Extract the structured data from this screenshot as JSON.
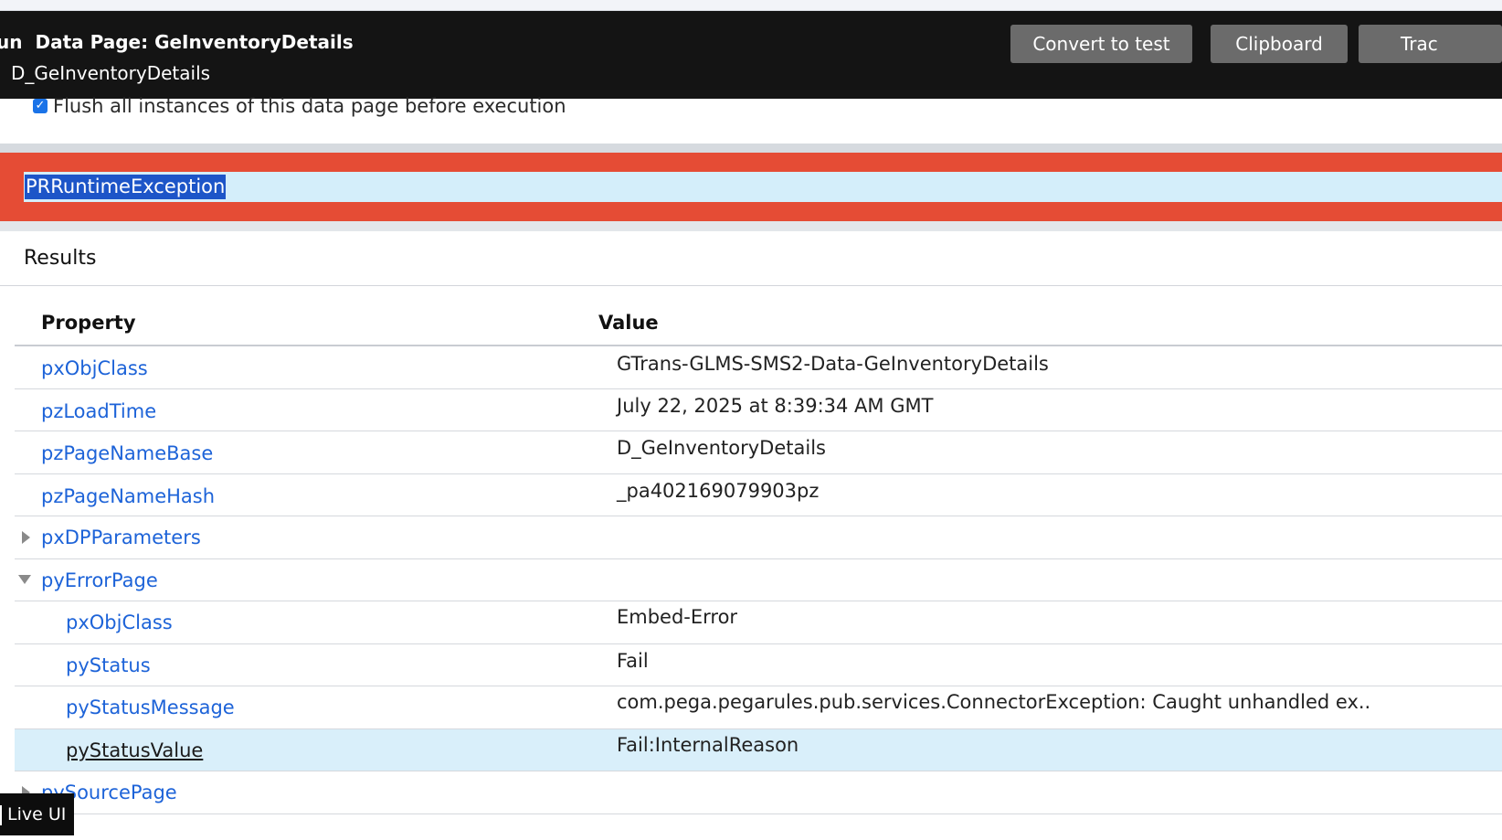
{
  "header": {
    "title_prefix": "un",
    "title_label": "Data Page:",
    "title_name": "GeInventoryDetails",
    "subtitle": "D_GeInventoryDetails",
    "buttons": [
      "Convert to test",
      "Clipboard",
      "Trac"
    ]
  },
  "flush_checkbox": {
    "checked": true,
    "label": "Flush all instances of this data page before execution"
  },
  "error": {
    "text": "PRRuntimeException"
  },
  "results": {
    "title": "Results",
    "columns": [
      "Property",
      "Value"
    ],
    "rows": [
      {
        "property": "pxObjClass",
        "value": "GTrans-GLMS-SMS2-Data-GeInventoryDetails"
      },
      {
        "property": "pzLoadTime",
        "value": "July 22, 2025 at 8:39:34 AM GMT"
      },
      {
        "property": "pzPageNameBase",
        "value": "D_GeInventoryDetails"
      },
      {
        "property": "pzPageNameHash",
        "value": "_pa402169079903pz"
      },
      {
        "property": "pxDPParameters",
        "value": "",
        "expander": "collapsed"
      },
      {
        "property": "pyErrorPage",
        "value": "",
        "expander": "expanded"
      },
      {
        "property": "pxObjClass",
        "value": "Embed-Error"
      },
      {
        "property": "pyStatus",
        "value": "Fail"
      },
      {
        "property": "pyStatusMessage",
        "value": "com.pega.pegarules.pub.services.ConnectorException: Caught unhandled ex.."
      },
      {
        "property": "pyStatusValue",
        "value": "Fail:InternalReason",
        "selected": true
      },
      {
        "property": "pySourcePage",
        "value": "",
        "expander": "collapsed"
      }
    ]
  },
  "live_ui": {
    "label": "Live UI"
  },
  "colors": {
    "header_bg": "#141414",
    "button_bg": "#6b6b6b",
    "error_band": "#e54c35",
    "error_inner": "#d4eefa",
    "link": "#1d63d8",
    "selected_row": "#d9effa",
    "checkbox": "#1a73e8"
  }
}
